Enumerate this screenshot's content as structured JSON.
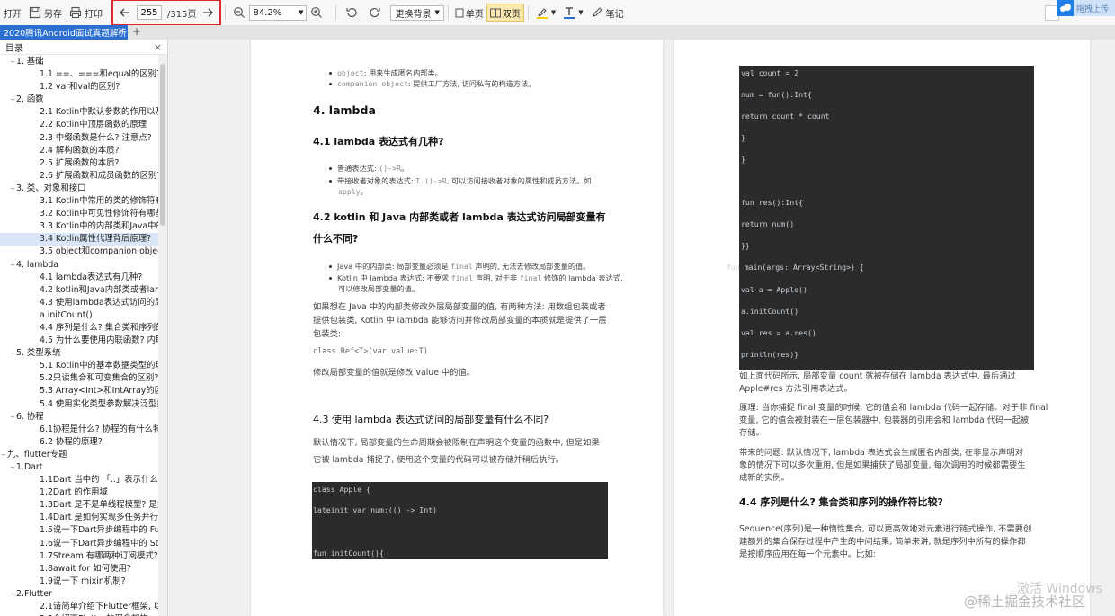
{
  "toolbar": {
    "open": "打开",
    "save_as": "另存",
    "print": "打印",
    "page_current": "255",
    "page_total": "/315页",
    "zoom": "84.2%",
    "background": "更换背景",
    "single_page": "单页",
    "double_page": "双页",
    "note": "笔记",
    "upload": "拖拽上传"
  },
  "tab": {
    "title": "2020腾讯Android面试真题解析"
  },
  "sidebar": {
    "title": "目录",
    "items": [
      {
        "label": "1. 基础",
        "level": 1,
        "toggle": "−"
      },
      {
        "label": "1.1 ==、===和equal的区别?",
        "level": 2
      },
      {
        "label": "1.2 var和val的区别?",
        "level": 2
      },
      {
        "label": "2. 函数",
        "level": 1,
        "toggle": "−"
      },
      {
        "label": "2.1 Kotlin中默认参数的作用以及原",
        "level": 2
      },
      {
        "label": "2.2 Kotlin中顶层函数的原理",
        "level": 2
      },
      {
        "label": "2.3 中缀函数是什么? 注意点?",
        "level": 2
      },
      {
        "label": "2.4 解构函数的本质?",
        "level": 2
      },
      {
        "label": "2.5 扩展函数的本质?",
        "level": 2
      },
      {
        "label": "2.6 扩展函数和成员函数的区别?",
        "level": 2
      },
      {
        "label": "3. 类、对象和接口",
        "level": 1,
        "toggle": "−"
      },
      {
        "label": "3.1 Kotlin中常用的类的修饰符有哪",
        "level": 2
      },
      {
        "label": "3.2 Kotlin中可见性修饰符有哪些?",
        "level": 2
      },
      {
        "label": "3.3 Kotlin中的内部类和Java中的内",
        "level": 2
      },
      {
        "label": "3.4 Kotlin属性代理背后原理?",
        "level": 2,
        "selected": true
      },
      {
        "label": "3.5 object和companion object的",
        "level": 2
      },
      {
        "label": "4. lambda",
        "level": 1,
        "toggle": "−"
      },
      {
        "label": "4.1 lambda表达式有几种?",
        "level": 2
      },
      {
        "label": "4.2 kotlin和Java内部类或者lamb",
        "level": 2
      },
      {
        "label": "4.3 使用lambda表达式访问的局部",
        "level": 2
      },
      {
        "label": "a.initCount()",
        "level": 2
      },
      {
        "label": "4.4 序列是什么? 集合类和序列的",
        "level": 2
      },
      {
        "label": "4.5 为什么要使用内联函数? 内联",
        "level": 2
      },
      {
        "label": "5. 类型系统",
        "level": 1,
        "toggle": "−"
      },
      {
        "label": "5.1 Kotlin中的基本数据类型的理解",
        "level": 2
      },
      {
        "label": "5.2只读集合和可变集合的区别?",
        "level": 2
      },
      {
        "label": "5.3 Array<Int>和IntArray的区别",
        "level": 2
      },
      {
        "label": "5.4 使用实化类型参数解决泛型擦",
        "level": 2
      },
      {
        "label": "6. 协程",
        "level": 1,
        "toggle": "−"
      },
      {
        "label": "6.1协程是什么? 协程的有什么特点",
        "level": 2
      },
      {
        "label": "6.2 协程的原理?",
        "level": 2
      },
      {
        "label": "九、flutter专题",
        "level": 0,
        "toggle": "−"
      },
      {
        "label": "1.Dart",
        "level": 1,
        "toggle": "−"
      },
      {
        "label": "1.1Dart 当中的 「..」表示什么意思",
        "level": 2
      },
      {
        "label": "1.2Dart 的作用域",
        "level": 2
      },
      {
        "label": "1.3Dart 是不是单线程模型? 是如何",
        "level": 2
      },
      {
        "label": "1.4Dart 是如何实现多任务并行的?",
        "level": 2
      },
      {
        "label": "1.5说一下Dart异步编程中的 Futur",
        "level": 2
      },
      {
        "label": "1.6说一下Dart异步编程中的 Strea",
        "level": 2
      },
      {
        "label": "1.7Stream 有哪两种订阅模式? 分",
        "level": 2
      },
      {
        "label": "1.8await for 如何使用?",
        "level": 2
      },
      {
        "label": "1.9说一下 mixin机制?",
        "level": 2
      },
      {
        "label": "2.Flutter",
        "level": 1,
        "toggle": "−"
      },
      {
        "label": "2.1请简单介绍下Flutter框架, 以及",
        "level": 2
      },
      {
        "label": "2.2介绍下Flutter的理念架构",
        "level": 2
      }
    ]
  },
  "left_page": {
    "top_bullets": [
      {
        "code": "object",
        "text": ": 用来生成匿名内部类。"
      },
      {
        "code": "companion object",
        "text": ": 提供工厂方法, 访问私有的构造方法。"
      }
    ],
    "h_lambda": "4. lambda",
    "h_41": "4.1 lambda 表达式有几种?",
    "b41_1_text": "普通表达式: ",
    "b41_1_code": "()->R",
    "b41_1_end": "。",
    "b41_2_a": "带接收者对象的表达式: ",
    "b41_2_code": "T.()->R",
    "b41_2_b": ", 可以访问接收者对象的属性和成员方法。如",
    "b41_2_c": "apply",
    "b41_2_end": "。",
    "h_42a": "4.2 kotlin 和 Java 内部类或者 lambda 表达式访问局部变量有",
    "h_42b": "什么不同?",
    "b42_1_a": "Java 中的内部类: 局部变量必须是 ",
    "b42_1_code": "final",
    "b42_1_b": " 声明的, 无法去修改局部变量的值。",
    "b42_2_a": "Kotlin 中 lambda 表达式: 不要求 ",
    "b42_2_code": "final",
    "b42_2_b": " 声明, 对于非 ",
    "b42_2_code2": "final",
    "b42_2_c": " 修饰的 lambda 表达式,",
    "b42_2_d": "可以修改局部变量的值。",
    "para_1": "如果想在 Java 中的内部类修改外层局部变量的值, 有两种方法: 用数组包装或者提供包装类, Kotlin 中 lambda 能够访问并修改局部变量的本质就是提供了一层包装类:",
    "code_line": "class Ref<T>(var value:T)",
    "para_2": "修改局部变量的值就是修改 value 中的值。",
    "h_43": "4.3 使用 lambda 表达式访问的局部变量有什么不同?",
    "para_3a": "默认情况下, 局部变量的生命周期会被限制在声明这个变量的函数中, 但是如果",
    "para_3b": "它被 lambda 捕捉了, 使用这个变量的代码可以被存储并稍后执行。",
    "code": [
      "class Apple {",
      "    lateinit var num:(() -> Int)",
      "    fun initCount(){"
    ]
  },
  "right_page": {
    "code": [
      "    val count = 2",
      "    num = fun():Int{",
      "        return count * count",
      "    }",
      "}",
      "fun res():Int{",
      "    return num()",
      "}}",
      "fun main(args: Array<String>) {",
      "    val a = Apple()",
      "    a.initCount()",
      "    val res = a.res()",
      "    println(res)}"
    ],
    "para_1a": "如上面代码所示, 局部变量 count 就被存储在 lambda 表达式中, 最后通过",
    "para_1b": "Apple#res 方法引用表达式。",
    "para_2a": "原理: 当你捕捉 final 变量的时候, 它的值会和 lambda 代码一起存储。对于非 final",
    "para_2b": "变量, 它的值会被封装在一层包装器中, 包装器的引用会和 lambda 代码一起被",
    "para_2c": "存储。",
    "para_3a": "带来的问题: 默认情况下, lambda 表达式会生成匿名内部类, 在非显示声明对",
    "para_3b": "象的情况下可以多次重用, 但是如果捕获了局部变量, 每次调用的时候都需要生",
    "para_3c": "成新的实例。",
    "h_44": "4.4 序列是什么? 集合类和序列的操作符比较?",
    "para_4a": "Sequence(序列)是一种惰性集合, 可以更高效地对元素进行链式操作, 不需要创",
    "para_4b": "建额外的集合保存过程中产生的中间结果, 简单来讲, 就是序列中所有的操作都",
    "para_4c": "是按顺序应用在每一个元素中。比如:"
  },
  "watermark": {
    "activate": "激活 Windows",
    "community": "@稀土掘金技术社区"
  },
  "colors": {
    "tab_active": "#2a6fd1",
    "highlight_red": "#e02a2a",
    "code_bg": "#2b2b2b"
  }
}
